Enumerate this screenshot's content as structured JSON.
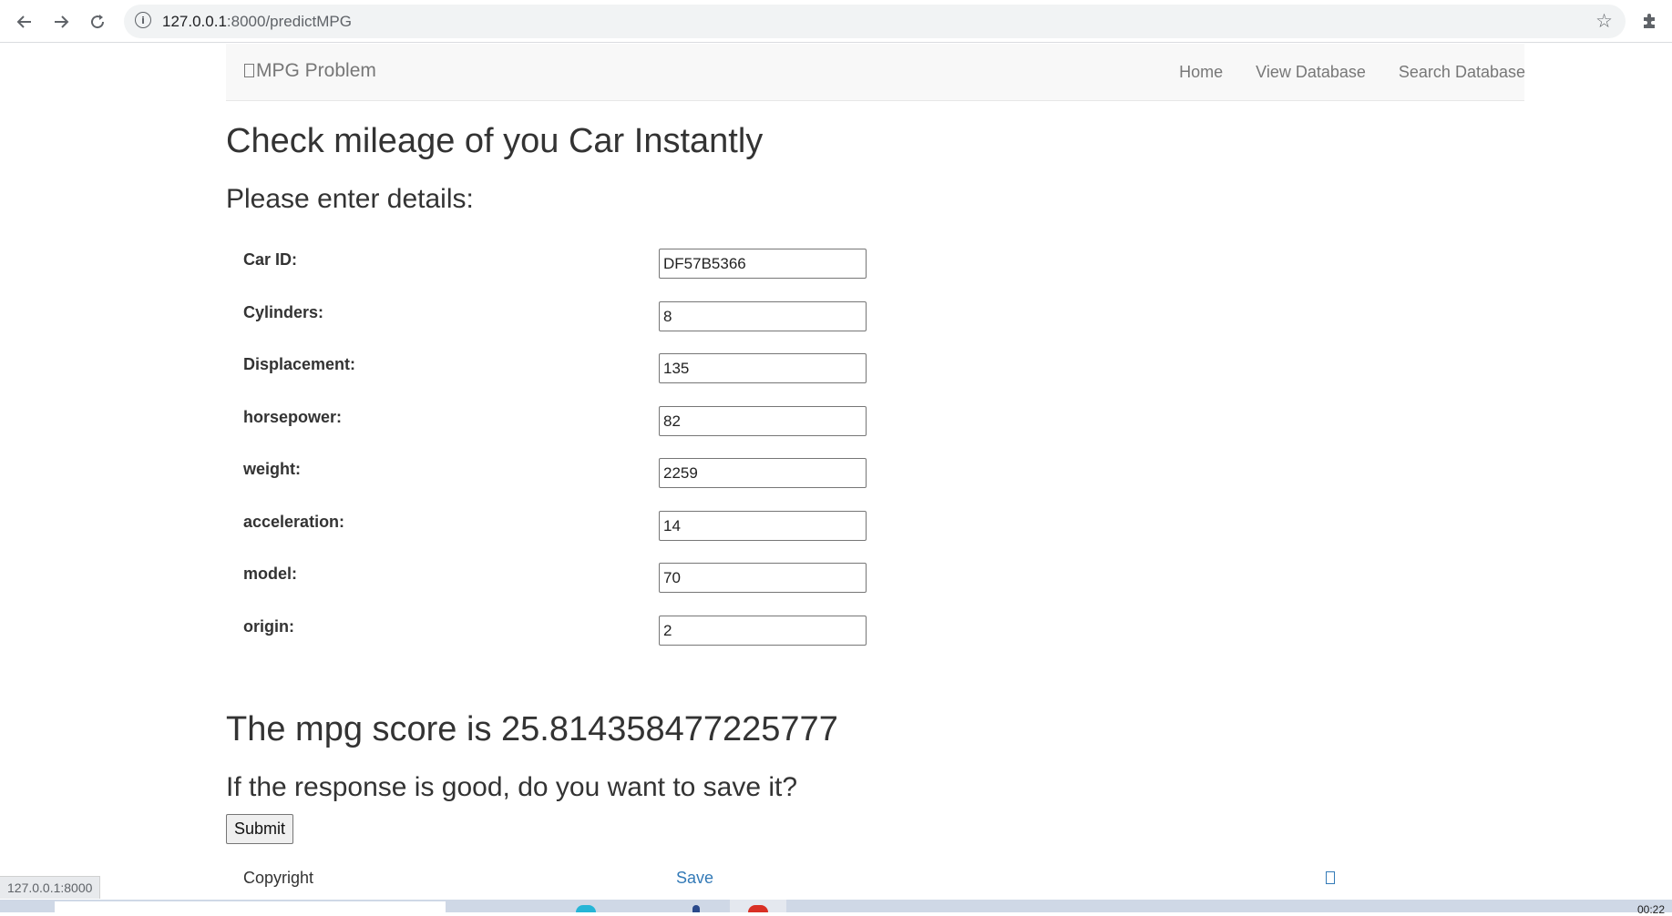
{
  "browser": {
    "url_host": "127.0.0.1",
    "url_rest": ":8000/predictMPG",
    "status_url": "127.0.0.1:8000"
  },
  "navbar": {
    "brand": "MPG Problem",
    "links": [
      "Home",
      "View Database",
      "Search Database"
    ]
  },
  "page": {
    "title": "Check mileage of you Car Instantly",
    "subtitle": "Please enter details:"
  },
  "form": {
    "fields": [
      {
        "label": "Car ID:",
        "value": "DF57B5366"
      },
      {
        "label": "Cylinders:",
        "value": "8"
      },
      {
        "label": "Displacement:",
        "value": "135"
      },
      {
        "label": "horsepower:",
        "value": "82"
      },
      {
        "label": "weight:",
        "value": "2259"
      },
      {
        "label": "acceleration:",
        "value": "14"
      },
      {
        "label": "model:",
        "value": "70"
      },
      {
        "label": "origin:",
        "value": "2"
      }
    ]
  },
  "result": {
    "score_text": "The mpg score is 25.814358477225777",
    "save_prompt": "If the response is good, do you want to save it?",
    "submit_label": "Submit"
  },
  "footer": {
    "copyright": "Copyright",
    "save_link": "Save"
  },
  "taskbar": {
    "clock": "00:22"
  },
  "colors": {
    "link": "#337ab7",
    "navbar_bg": "#f8f8f8",
    "text": "#333333"
  }
}
